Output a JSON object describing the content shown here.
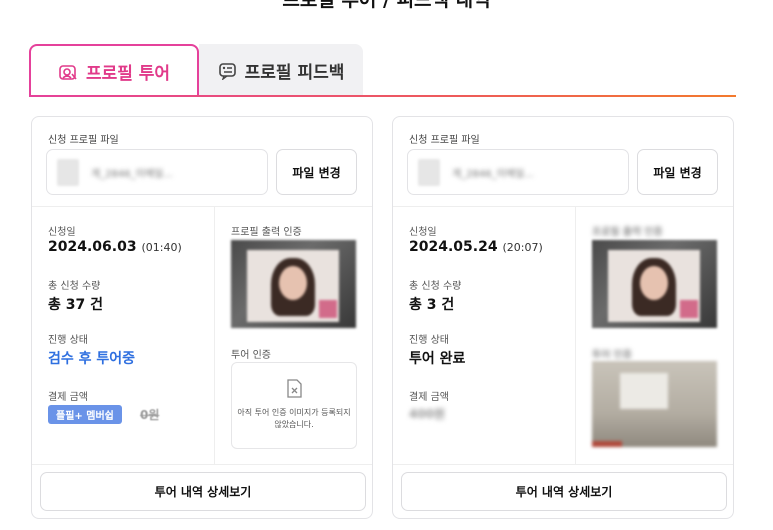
{
  "page": {
    "title": "프로필 투어 / 피드백 내역"
  },
  "tabs": [
    {
      "label": "프로필 투어",
      "icon": "profile-tour-icon",
      "active": true
    },
    {
      "label": "프로필 피드백",
      "icon": "feedback-icon",
      "active": false
    }
  ],
  "colors": {
    "accent": "#e5419b",
    "gradient_end": "#f37a2d",
    "status_blue": "#2e6fe0",
    "badge_blue": "#6a93e8"
  },
  "cards": [
    {
      "file_label": "신청 프로필 파일",
      "file_name": "게_2846_이메일...",
      "change_button": "파일 변경",
      "date_label": "신청일",
      "date": "2024.06.03",
      "time": "(01:40)",
      "qty_label": "총 신청 수량",
      "qty": "총 37 건",
      "status_label": "진행 상태",
      "status": "검수 후 투어중",
      "pay_label": "결제 금액",
      "pay_badge": "플필+ 멤버쉽",
      "pay_amount": "0원",
      "output_label": "프로필 출력 인증",
      "tour_label": "투어 인증",
      "tour_empty_text": "아직 투어 인증 이미지가 등록되지 않았습니다.",
      "detail_button": "투어 내역 상세보기"
    },
    {
      "file_label": "신청 프로필 파일",
      "file_name": "게_2846_이메일...",
      "change_button": "파일 변경",
      "date_label": "신청일",
      "date": "2024.05.24",
      "time": "(20:07)",
      "qty_label": "총 신청 수량",
      "qty": "총 3 건",
      "status_label": "진행 상태",
      "status": "투어 완료",
      "pay_label": "결제 금액",
      "pay_amount": "400원",
      "output_label": "프로필 출력 인증",
      "tour_label": "투어 인증",
      "detail_button": "투어 내역 상세보기"
    }
  ]
}
